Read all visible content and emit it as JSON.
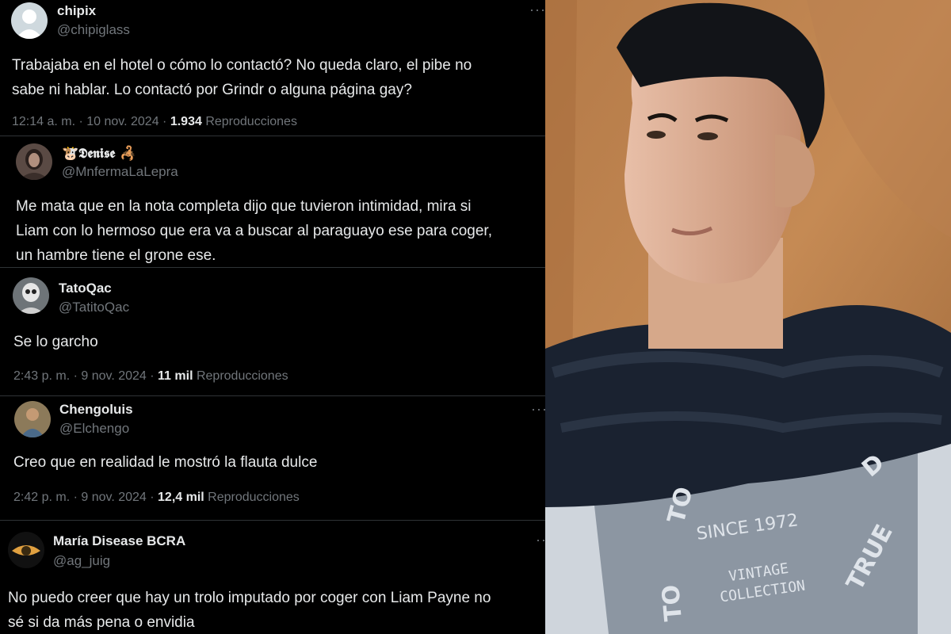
{
  "colors": {
    "background": "#000000",
    "text": "#e7e9ea",
    "secondary_text": "#71767b",
    "divider": "#2f3336"
  },
  "tweets": [
    {
      "name": "chipix",
      "handle": "@chipiglass",
      "text": "Trabajaba en el hotel o cómo lo contactó? No queda claro, el pibe no\nsabe ni hablar. Lo contactó por Grindr o alguna página gay?",
      "time": "12:14 a. m. · 10 nov. 2024 · ",
      "views": "1.934",
      "views_label": " Reproducciones",
      "more": "···",
      "avatar": "default-avatar-icon"
    },
    {
      "name": "🐮𝕯𝖊𝖓𝖎𝖘𝖊 🦂",
      "handle": "@MnfermaLaLepra",
      "text": "Me mata que en la nota completa dijo que tuvieron intimidad, mira si\nLiam con lo hermoso que era va a buscar al  paraguayo ese para coger,\nun hambre tiene el grone ese.",
      "avatar": "profile-photo-icon"
    },
    {
      "name": "TatoQac",
      "handle": "@TatitoQac",
      "text": "Se lo garcho",
      "time": "2:43 p. m. · 9 nov. 2024 · ",
      "views": "11 mil",
      "views_label": " Reproducciones",
      "avatar": "skull-avatar-icon"
    },
    {
      "name": "Chengoluis",
      "handle": "@Elchengo",
      "text": "Creo que en realidad le mostró la flauta dulce",
      "time": "2:42 p. m. · 9 nov. 2024 · ",
      "views": "12,4 mil",
      "views_label": " Reproducciones",
      "more": "···",
      "avatar": "profile-photo-icon"
    },
    {
      "name": "María Disease BCRA",
      "handle": "@ag_juig",
      "text": "No puedo creer que hay un trolo imputado por coger con Liam Payne no\nsé si da más pena o envidia",
      "more": "··",
      "avatar": "eye-avatar-icon"
    }
  ],
  "photo": {
    "subject": "man-portrait-photo",
    "shirt_text_1": "SINCE 1972",
    "shirt_text_2": "VINTAGE",
    "shirt_text_3": "COLLECTION",
    "shirt_text_4": "TRUE",
    "shirt_text_5": "TO",
    "shirt_text_6": "TO",
    "shirt_text_7": "D"
  }
}
